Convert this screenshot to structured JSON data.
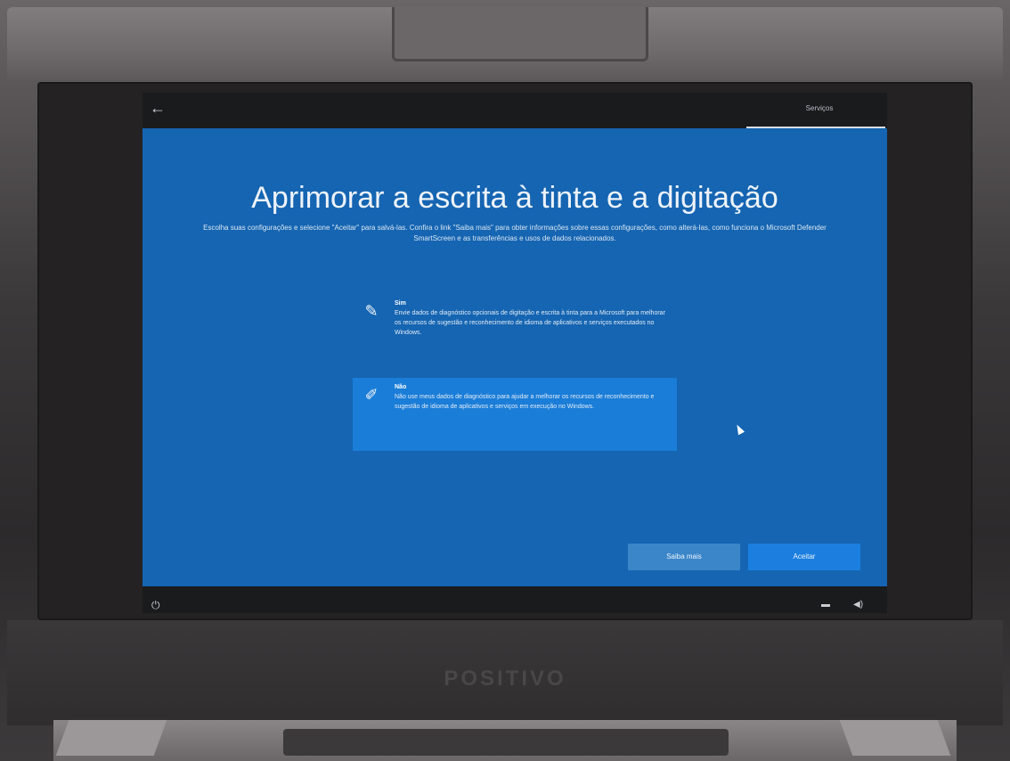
{
  "header": {
    "section": "Serviços",
    "back_icon": "back-arrow-icon"
  },
  "main": {
    "title": "Aprimorar a escrita à tinta e a digitação",
    "subtitle": "Escolha suas configurações e selecione \"Aceitar\" para salvá-las. Confira o link \"Saiba mais\" para obter informações sobre essas configurações, como alterá-las, como funciona o Microsoft Defender SmartScreen e as transferências e usos de dados relacionados."
  },
  "options": [
    {
      "title": "Sim",
      "description": "Envie dados de diagnóstico opcionais de digitação e escrita à tinta para a Microsoft para melhorar os recursos de sugestão e reconhecimento de idioma de aplicativos e serviços executados no Windows.",
      "icon": "pen-icon",
      "selected": false
    },
    {
      "title": "Não",
      "description": "Não use meus dados de diagnóstico para ajudar a melhorar os recursos de reconhecimento e sugestão de idioma de aplicativos e serviços em execução no Windows.",
      "icon": "pen-off-icon",
      "selected": true
    }
  ],
  "buttons": {
    "learn_more": "Saiba mais",
    "accept": "Aceitar"
  },
  "footer": {
    "power_icon": "power-icon",
    "network_icon": "network-icon",
    "volume_icon": "volume-icon"
  },
  "device": {
    "brand": "POSITIVO"
  },
  "colors": {
    "oobe_background": "#1565b2",
    "selected_option": "#1a7dd8",
    "accept_button": "#1c7fe0"
  }
}
